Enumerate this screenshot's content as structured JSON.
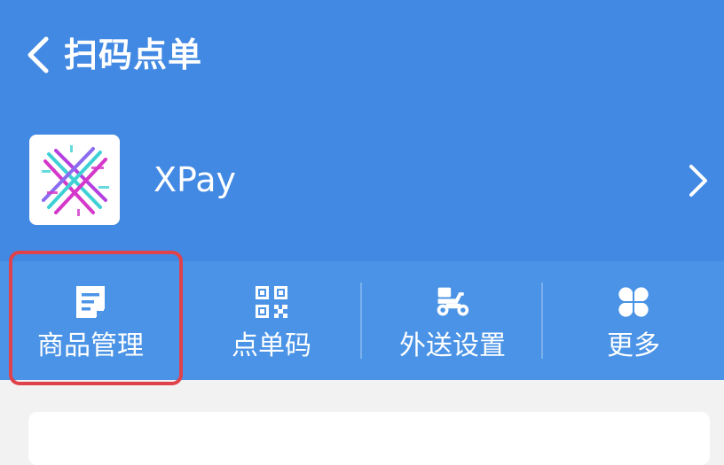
{
  "header": {
    "back_icon": "chevron-left-icon",
    "title": "扫码点单"
  },
  "merchant": {
    "logo": "xpay-logo",
    "name": "XPay",
    "arrow_icon": "chevron-right-icon"
  },
  "toolbar": {
    "items": [
      {
        "label": "商品管理",
        "icon": "document-icon",
        "highlighted": true
      },
      {
        "label": "点单码",
        "icon": "qr-code-icon"
      },
      {
        "label": "外送设置",
        "icon": "scooter-icon"
      },
      {
        "label": "更多",
        "icon": "clover-icon"
      }
    ]
  },
  "colors": {
    "header_bg": "#4289e3",
    "toolbar_bg": "#4a93e6",
    "highlight": "#e0424b",
    "page_bg": "#f2f2f2"
  }
}
